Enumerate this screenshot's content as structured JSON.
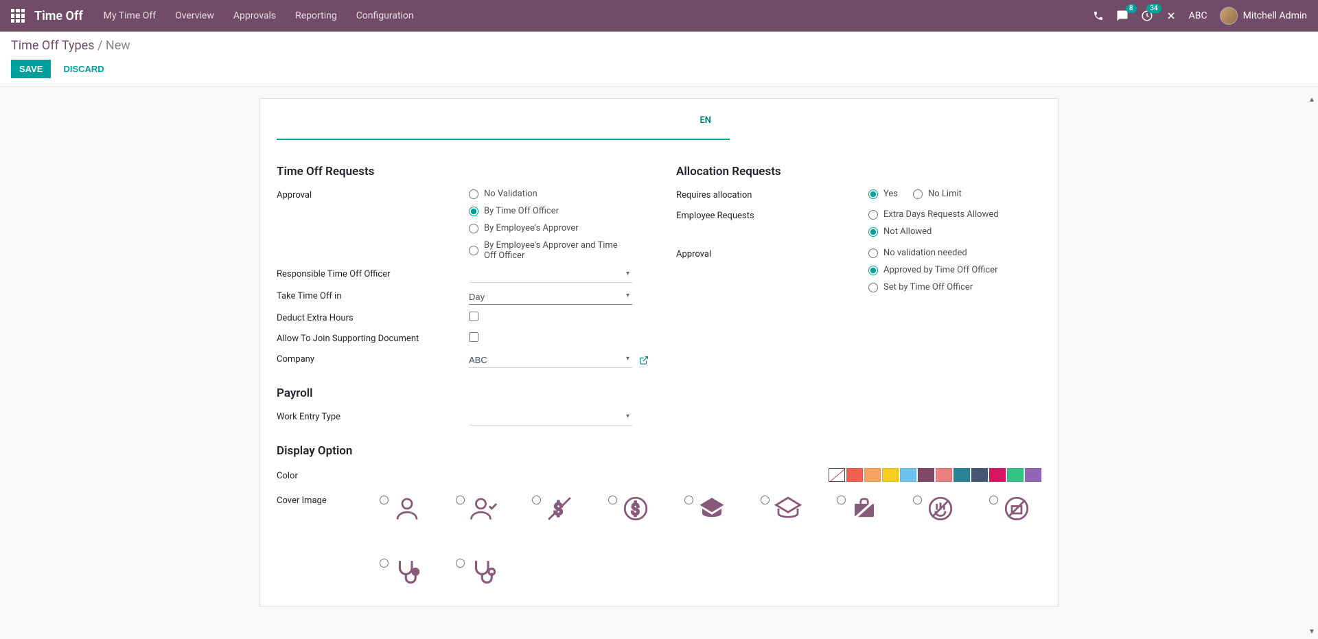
{
  "header": {
    "app_title": "Time Off",
    "nav": [
      "My Time Off",
      "Overview",
      "Approvals",
      "Reporting",
      "Configuration"
    ],
    "messages_badge": "8",
    "activities_badge": "34",
    "company": "ABC",
    "user": "Mitchell Admin"
  },
  "breadcrumb": {
    "parent": "Time Off Types",
    "current": "New"
  },
  "buttons": {
    "save": "SAVE",
    "discard": "DISCARD"
  },
  "lang_badge": "EN",
  "sections": {
    "time_off_requests": {
      "title": "Time Off Requests",
      "approval_label": "Approval",
      "approval_options": [
        {
          "label": "No Validation",
          "checked": false
        },
        {
          "label": "By Time Off Officer",
          "checked": true
        },
        {
          "label": "By Employee's Approver",
          "checked": false
        },
        {
          "label": "By Employee's Approver and Time Off Officer",
          "checked": false
        }
      ],
      "responsible_label": "Responsible Time Off Officer",
      "take_label": "Take Time Off in",
      "take_value": "Day",
      "deduct_label": "Deduct Extra Hours",
      "allow_doc_label": "Allow To Join Supporting Document",
      "company_label": "Company",
      "company_value": "ABC"
    },
    "allocation_requests": {
      "title": "Allocation Requests",
      "requires_label": "Requires allocation",
      "requires_options": [
        {
          "label": "Yes",
          "checked": true
        },
        {
          "label": "No Limit",
          "checked": false
        }
      ],
      "employee_req_label": "Employee Requests",
      "employee_req_options": [
        {
          "label": "Extra Days Requests Allowed",
          "checked": false
        },
        {
          "label": "Not Allowed",
          "checked": true
        }
      ],
      "approval_label": "Approval",
      "approval_options": [
        {
          "label": "No validation needed",
          "checked": false
        },
        {
          "label": "Approved by Time Off Officer",
          "checked": true
        },
        {
          "label": "Set by Time Off Officer",
          "checked": false
        }
      ]
    },
    "payroll": {
      "title": "Payroll",
      "work_entry_label": "Work Entry Type"
    },
    "display": {
      "title": "Display Option",
      "color_label": "Color",
      "cover_label": "Cover Image",
      "colors": [
        "none",
        "#f06050",
        "#f4a460",
        "#f7cd1f",
        "#6cc1ed",
        "#814968",
        "#eb7e7f",
        "#2c8397",
        "#475577",
        "#d6145f",
        "#30c381",
        "#9365b8"
      ]
    }
  }
}
